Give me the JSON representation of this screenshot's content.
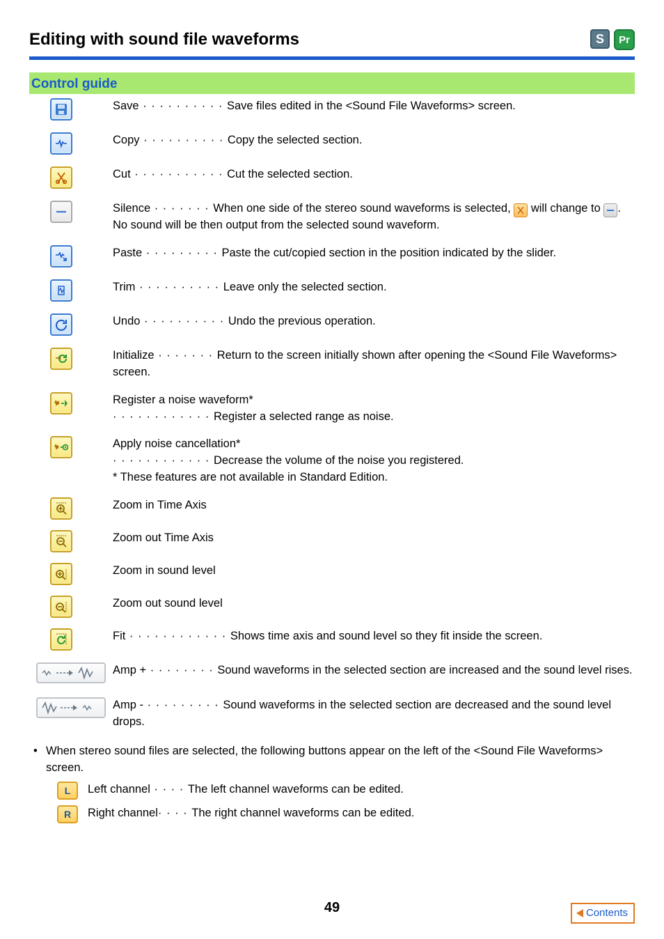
{
  "header": {
    "title": "Editing with sound file waveforms",
    "badge_s": "S",
    "badge_pr": "Pr"
  },
  "section_title": "Control guide",
  "rows": {
    "save": {
      "label": "Save",
      "dots": " · · · · · · · · · · ",
      "desc": "Save files edited in the <Sound File Waveforms> screen."
    },
    "copy": {
      "label": "Copy",
      "dots": " · · · · · · · · · · ",
      "desc": "Copy the selected section."
    },
    "cut": {
      "label": "Cut",
      "dots": " · · · · · · · · · · · ",
      "desc": "Cut the selected section."
    },
    "silence": {
      "label": "Silence",
      "dots": " · · · · · · · ",
      "desc_a": "When one side of the stereo sound waveforms is selected, ",
      "desc_b": " will change to ",
      "desc_c": ". No sound will be then output from the selected sound waveform."
    },
    "paste": {
      "label": "Paste",
      "dots": " · · · · · · · · · ",
      "desc": "Paste the cut/copied section in the position indicated by the slider."
    },
    "trim": {
      "label": "Trim",
      "dots": " · · · · · · · · · · ",
      "desc": "Leave only the selected section."
    },
    "undo": {
      "label": "Undo",
      "dots": " · · · · · · · · · · ",
      "desc": "Undo the previous operation."
    },
    "init": {
      "label": "Initialize",
      "dots": " · · · · · · · ",
      "desc": "Return to the screen initially shown after opening the <Sound File Waveforms> screen."
    },
    "regnoise": {
      "title": "Register a noise waveform*",
      "dots": " · · · · · · · · · · · · ",
      "desc": "Register a selected range as noise."
    },
    "applync": {
      "title": "Apply noise cancellation*",
      "dots": " · · · · · · · · · · · · ",
      "desc": "Decrease the volume of the noise you registered.",
      "note": "* These features are not available in Standard Edition."
    },
    "zita": {
      "label": "Zoom in Time Axis"
    },
    "zota": {
      "label": "Zoom out Time Axis"
    },
    "zisl": {
      "label": "Zoom in sound level"
    },
    "zosl": {
      "label": "Zoom out sound level"
    },
    "fit": {
      "label": "Fit",
      "dots": " · · · · · · · · · · · · ",
      "desc": "Shows time axis and sound level so they fit inside the screen."
    },
    "ampp": {
      "label": "Amp +",
      "dots": " · · · · · · · · ",
      "desc": "Sound waveforms in the selected section are increased and the sound level rises."
    },
    "ampm": {
      "label": "Amp -",
      "dots": " · · · · · · · · · ",
      "desc": "Sound waveforms in the selected section are decreased and the sound level drops."
    }
  },
  "footer": {
    "intro": "When stereo sound files are selected, the following buttons appear on the left of the <Sound File Waveforms> screen.",
    "left": {
      "label": "Left channel",
      "dots": " · · · · ",
      "desc": "The left channel waveforms can be edited.",
      "icon_letter": "L"
    },
    "right": {
      "label": "Right channel",
      "dots": "· · · · ",
      "desc": "The right channel waveforms can be edited.",
      "icon_letter": "R"
    }
  },
  "page_number": "49",
  "contents_label": "Contents"
}
